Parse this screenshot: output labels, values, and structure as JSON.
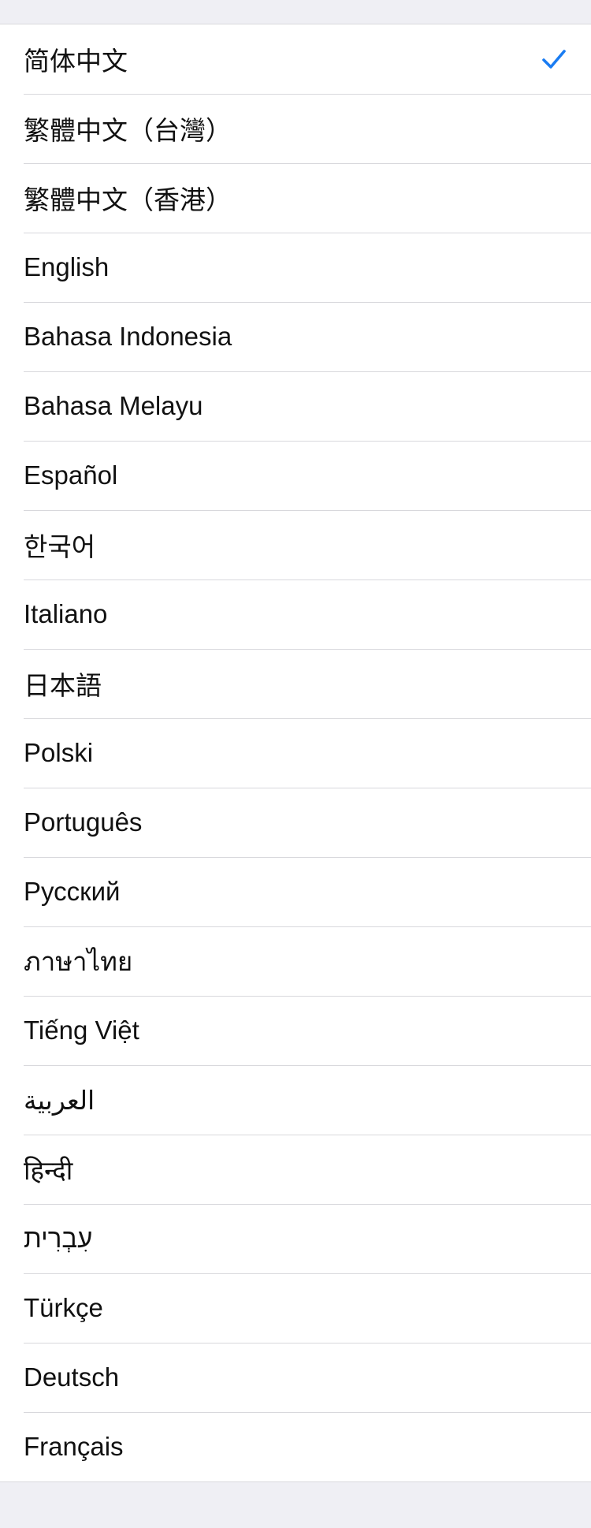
{
  "accent_color": "#1a7cf2",
  "languages": [
    {
      "label": "简体中文",
      "selected": true
    },
    {
      "label": "繁體中文（台灣）",
      "selected": false
    },
    {
      "label": "繁體中文（香港）",
      "selected": false
    },
    {
      "label": "English",
      "selected": false
    },
    {
      "label": "Bahasa Indonesia",
      "selected": false
    },
    {
      "label": "Bahasa Melayu",
      "selected": false
    },
    {
      "label": "Español",
      "selected": false
    },
    {
      "label": "한국어",
      "selected": false
    },
    {
      "label": "Italiano",
      "selected": false
    },
    {
      "label": "日本語",
      "selected": false
    },
    {
      "label": "Polski",
      "selected": false
    },
    {
      "label": "Português",
      "selected": false
    },
    {
      "label": "Русский",
      "selected": false
    },
    {
      "label": "ภาษาไทย",
      "selected": false
    },
    {
      "label": "Tiếng Việt",
      "selected": false
    },
    {
      "label": "العربية",
      "selected": false
    },
    {
      "label": "हिन्दी",
      "selected": false
    },
    {
      "label": "עִבְרִית",
      "selected": false
    },
    {
      "label": "Türkçe",
      "selected": false
    },
    {
      "label": "Deutsch",
      "selected": false
    },
    {
      "label": "Français",
      "selected": false
    }
  ],
  "check_icon": "checkmark-icon"
}
